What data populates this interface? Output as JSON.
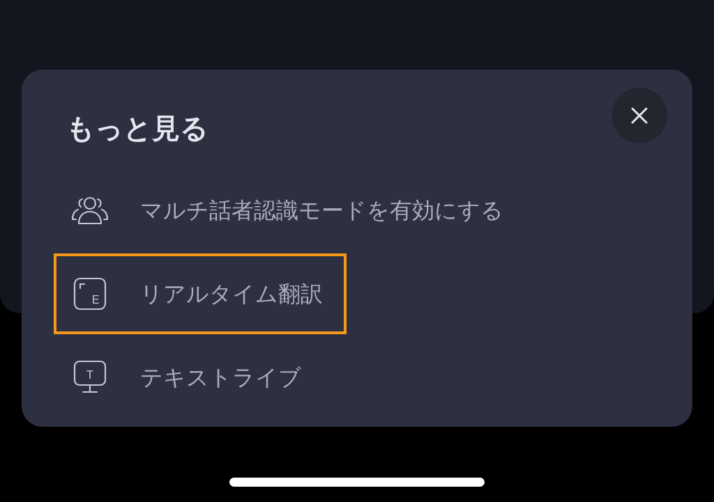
{
  "sheet": {
    "title": "もっと見る",
    "items": [
      {
        "kind": "people",
        "label": "マルチ話者認識モードを有効にする",
        "highlighted": false
      },
      {
        "kind": "translate",
        "glyph": "E",
        "label": "リアルタイム翻訳",
        "highlighted": true
      },
      {
        "kind": "monitor",
        "glyph": "T",
        "label": "テキストライブ",
        "highlighted": false
      }
    ]
  }
}
